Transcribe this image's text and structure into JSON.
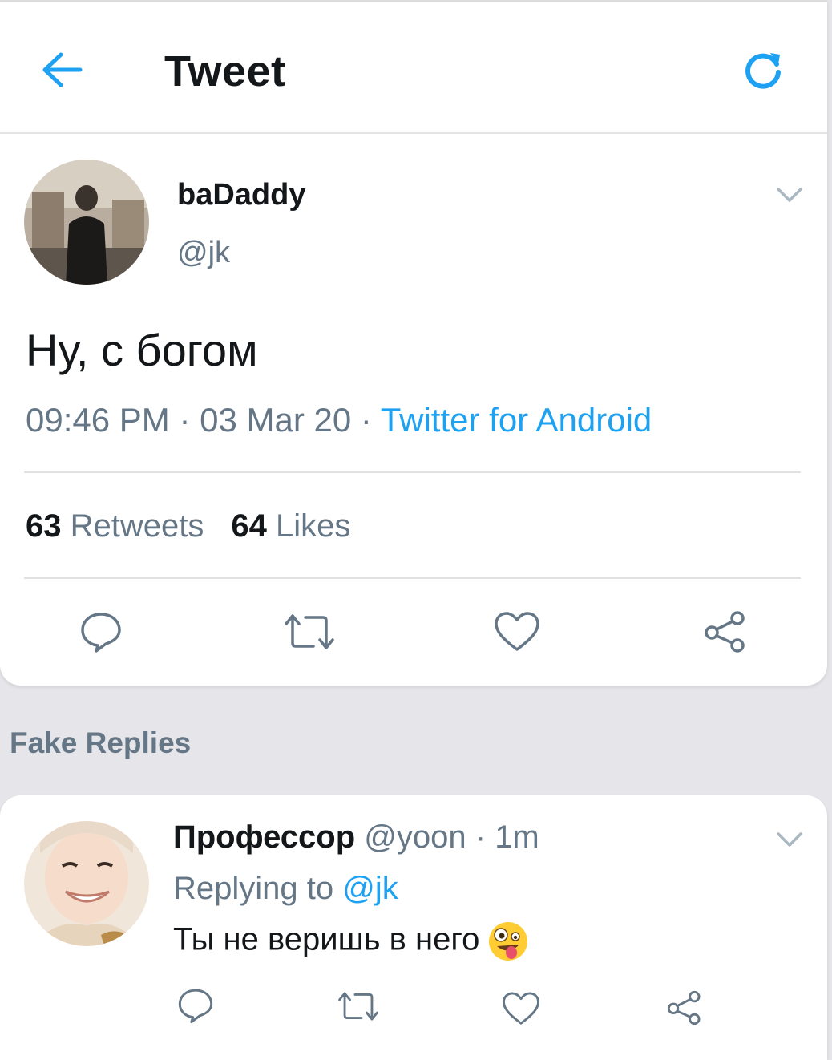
{
  "header": {
    "title": "Tweet",
    "back_icon": "arrow-left-icon",
    "refresh_icon": "refresh-icon"
  },
  "tweet": {
    "display_name": "baDaddy",
    "handle": "@jk",
    "text": "Ну, с богом",
    "time": "09:46 PM",
    "date": "03 Mar 20",
    "source": "Twitter for Android",
    "separator": " · ",
    "retweets_count": "63",
    "retweets_label": "Retweets",
    "likes_count": "64",
    "likes_label": "Likes"
  },
  "section_label": "Fake Replies",
  "reply": {
    "display_name": "Профессор",
    "handle": "@yoon",
    "time_sep": " · ",
    "time": "1m",
    "replying_prefix": "Replying to",
    "replying_to": "@jk",
    "text": "Ты не веришь в него",
    "emoji": "zany-face-emoji"
  },
  "colors": {
    "accent": "#1da1f2",
    "muted": "#657786",
    "text": "#14171a",
    "background": "#e6e6ea"
  }
}
